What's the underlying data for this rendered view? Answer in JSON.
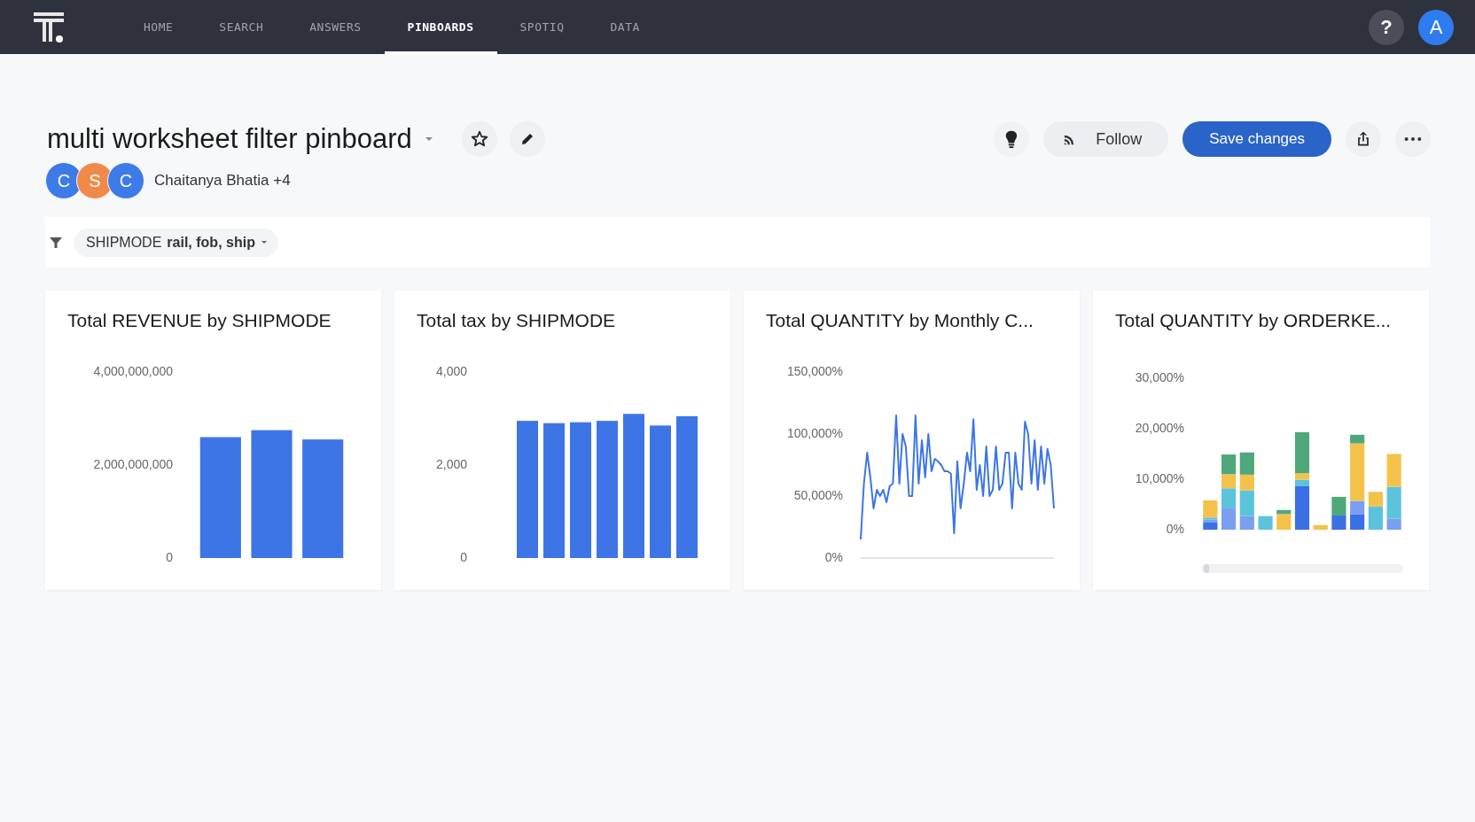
{
  "nav": {
    "items": [
      {
        "label": "HOME",
        "selected": false
      },
      {
        "label": "SEARCH",
        "selected": false
      },
      {
        "label": "ANSWERS",
        "selected": false
      },
      {
        "label": "PINBOARDS",
        "selected": true
      },
      {
        "label": "SPOTIQ",
        "selected": false
      },
      {
        "label": "DATA",
        "selected": false
      }
    ],
    "help": "?",
    "user_initial": "A"
  },
  "pinboard": {
    "title": "multi worksheet filter pinboard",
    "avatars": [
      {
        "letter": "C",
        "color": "#3d7be8"
      },
      {
        "letter": "S",
        "color": "#f08a4b"
      },
      {
        "letter": "C",
        "color": "#3d7be8"
      }
    ],
    "owners": "Chaitanya Bhatia +4",
    "follow": "Follow",
    "save": "Save changes"
  },
  "filters": [
    {
      "text": "SHIPMODE **rail, fob, ship**"
    }
  ],
  "cards": [
    {
      "chart_data": {
        "type": "bar",
        "title": "Total REVENUE by SHIPMODE",
        "series": [
          {
            "color": "#3d75e6",
            "values": [
              2600000000,
              2750000000,
              2550000000
            ]
          }
        ],
        "ylim": [
          0,
          4000000000
        ],
        "yticks": [
          {
            "value": 0,
            "label": "0"
          },
          {
            "value": 2000000000,
            "label": "2,000,000,000"
          },
          {
            "value": 4000000000,
            "label": "4,000,000,000"
          }
        ]
      }
    },
    {
      "chart_data": {
        "type": "bar",
        "title": "Total tax by SHIPMODE",
        "series": [
          {
            "color": "#3d75e6",
            "values": [
              2950,
              2900,
              2920,
              2950,
              3100,
              2850,
              3050
            ]
          }
        ],
        "ylim": [
          0,
          4000
        ],
        "yticks": [
          {
            "value": 0,
            "label": "0"
          },
          {
            "value": 2000,
            "label": "2,000"
          },
          {
            "value": 4000,
            "label": "4,000"
          }
        ]
      }
    },
    {
      "chart_data": {
        "type": "line",
        "title": "Total QUANTITY by Monthly C...",
        "ylim": [
          0,
          150000
        ],
        "yticks": [
          {
            "value": 0,
            "label": "0%"
          },
          {
            "value": 50000,
            "label": "50,000%"
          },
          {
            "value": 100000,
            "label": "100,000%"
          },
          {
            "value": 150000,
            "label": "150,000%"
          }
        ],
        "values": [
          15000,
          60000,
          85000,
          65000,
          40000,
          55000,
          50000,
          55000,
          45000,
          58000,
          60000,
          115000,
          60000,
          100000,
          90000,
          50000,
          50000,
          115000,
          60000,
          95000,
          65000,
          100000,
          70000,
          80000,
          78000,
          75000,
          70000,
          70000,
          68000,
          20000,
          78000,
          40000,
          60000,
          85000,
          70000,
          112000,
          55000,
          75000,
          50000,
          90000,
          50000,
          55000,
          90000,
          55000,
          60000,
          85000,
          85000,
          40000,
          85000,
          60000,
          55000,
          110000,
          100000,
          60000,
          95000,
          55000,
          90000,
          60000,
          88000,
          75000,
          40000
        ]
      }
    },
    {
      "chart_data": {
        "type": "bar",
        "stacked": true,
        "title": "Total QUANTITY by ORDERKE...",
        "ylim": [
          0,
          30000
        ],
        "yticks": [
          {
            "value": 0,
            "label": "0%"
          },
          {
            "value": 10000,
            "label": "10,000%"
          },
          {
            "value": 20000,
            "label": "20,000%"
          },
          {
            "value": 30000,
            "label": "30,000%"
          }
        ],
        "series": [
          {
            "color": "#3a6fe6",
            "values": [
              1500,
              0,
              0,
              0,
              0,
              8600,
              0,
              2800,
              3000,
              0,
              0
            ]
          },
          {
            "color": "#7a9ef0",
            "values": [
              500,
              4200,
              2700,
              0,
              0,
              0,
              0,
              0,
              2700,
              0,
              2200
            ]
          },
          {
            "color": "#5cc3dd",
            "values": [
              400,
              4000,
              5100,
              2700,
              0,
              1300,
              0,
              0,
              0,
              4600,
              6300
            ]
          },
          {
            "color": "#f4c14a",
            "values": [
              3400,
              2800,
              3100,
              0,
              3100,
              1300,
              900,
              0,
              11400,
              2900,
              6500
            ]
          },
          {
            "color": "#4fa87a",
            "values": [
              0,
              3900,
              4400,
              0,
              800,
              8100,
              0,
              3700,
              1700,
              0,
              0
            ]
          }
        ]
      }
    }
  ]
}
